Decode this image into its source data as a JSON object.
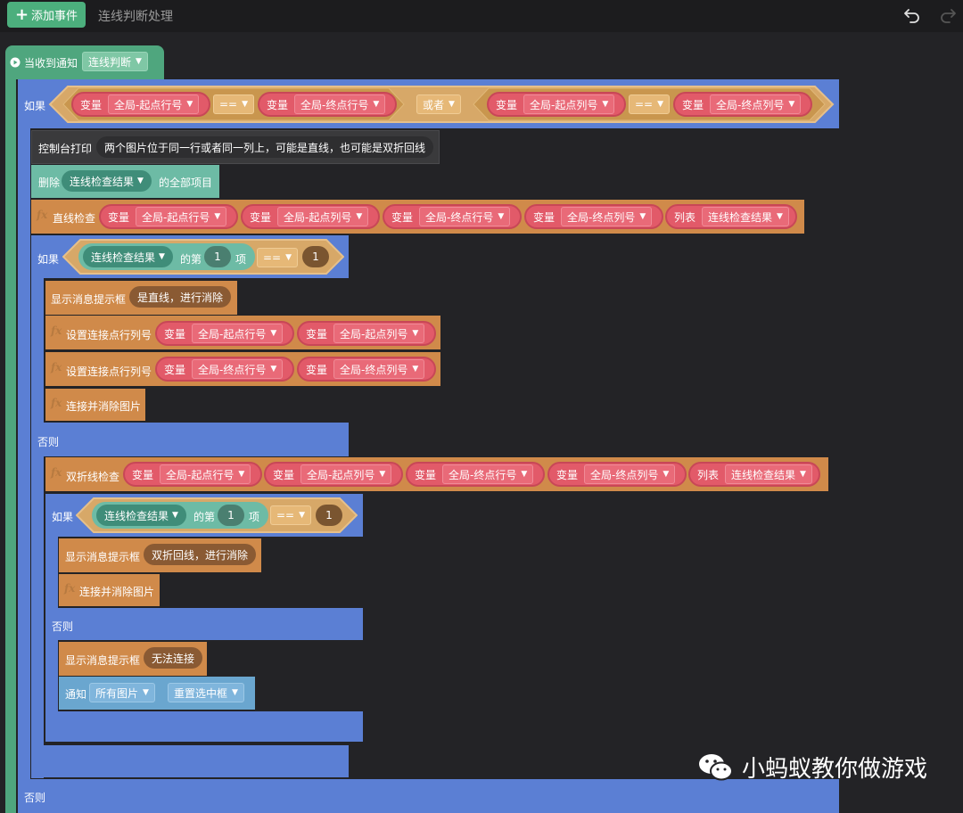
{
  "toolbar": {
    "add_label": "添加事件",
    "title": "连线判断处理"
  },
  "event": {
    "label": "当收到通知",
    "value": "连线判断"
  },
  "var": "变量",
  "list": "列表",
  "ops": {
    "eq": "==",
    "or": "或者"
  },
  "globals": {
    "start_row": "全局-起点行号",
    "end_row": "全局-终点行号",
    "start_col": "全局-起点列号",
    "end_col": "全局-终点列号"
  },
  "if1": {
    "label": "如果",
    "else": "否则"
  },
  "print": {
    "label": "控制台打印",
    "text": "两个图片位于同一行或者同一列上，可能是直线，也可能是双折回线"
  },
  "del": {
    "label": "删除",
    "list": "连线检查结果",
    "suffix": "的全部项目"
  },
  "line_check": {
    "label": "直线检查",
    "list": "连线检查结果"
  },
  "if2": {
    "label": "如果",
    "list": "连线检查结果",
    "nth": "的第",
    "idx": "1",
    "item": "项",
    "val": "1",
    "else": "否则"
  },
  "toast1": {
    "label": "显示消息提示框",
    "text": "是直线，进行消除"
  },
  "set_pt": {
    "label": "设置连接点行列号"
  },
  "connect": {
    "label": "连接并消除图片"
  },
  "fold": {
    "label": "双折线检查",
    "list": "连线检查结果"
  },
  "if3": {
    "label": "如果",
    "list": "连线检查结果",
    "nth": "的第",
    "idx": "1",
    "item": "项",
    "val": "1",
    "else": "否则"
  },
  "toast2": {
    "label": "显示消息提示框",
    "text": "双折回线，进行消除"
  },
  "toast3": {
    "label": "显示消息提示框",
    "text": "无法连接"
  },
  "notify": {
    "label": "通知",
    "target": "所有图片",
    "msg": "重置选中框"
  },
  "else_bottom": "否则",
  "watermark": "小蚂蚁教你做游戏",
  "colors": {
    "event": "#4fa67e",
    "control": "#5b7fd4",
    "func": "#d08a4a",
    "var": "#e25a69",
    "list": "#6dbba5",
    "cond": "#d7a868"
  }
}
